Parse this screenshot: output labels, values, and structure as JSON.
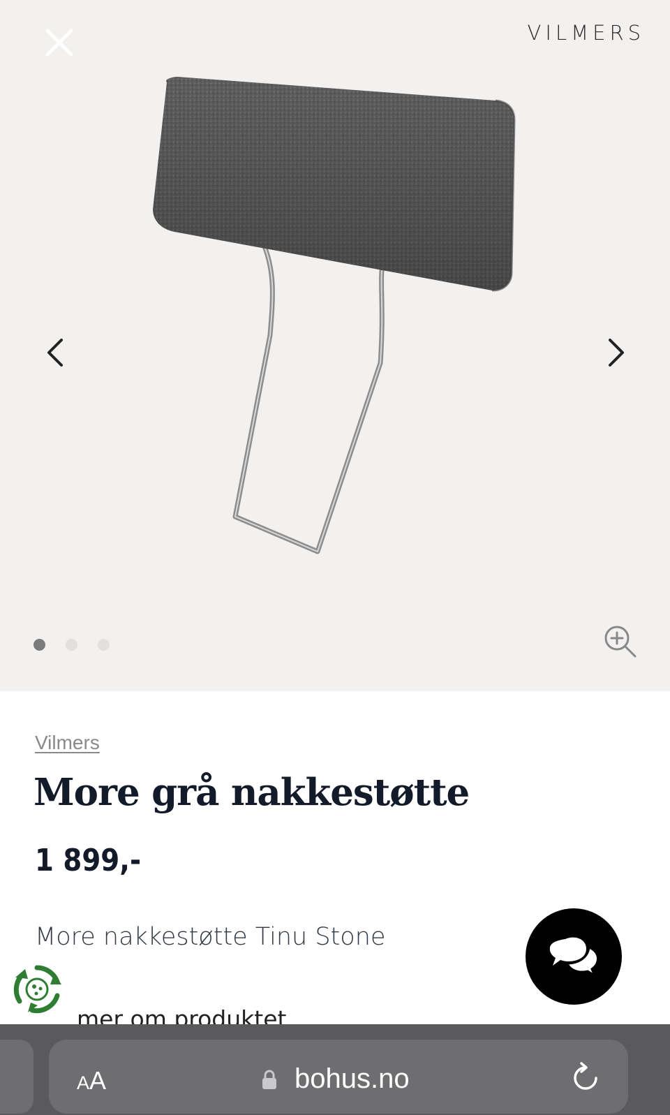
{
  "gallery": {
    "brand_logo": "VILMERS",
    "close_icon": "close-icon",
    "prev_icon": "chevron-left-icon",
    "next_icon": "chevron-right-icon",
    "zoom_icon": "zoom-in-icon",
    "image_count": 3,
    "active_image": 1
  },
  "product": {
    "brand": "Vilmers",
    "title": "More grå nakkestøtte",
    "price": "1 899,-",
    "subtitle": "More nakkestøtte Tinu Stone",
    "more_link": "mer om produktet"
  },
  "chat": {
    "icon": "chat-bubbles-icon"
  },
  "browser": {
    "aa_label_small": "A",
    "aa_label_large": "A",
    "url": "bohus.no",
    "lock_icon": "lock-icon",
    "reload_icon": "reload-icon"
  },
  "colors": {
    "gallery_bg": "#f3f1f0",
    "title_color": "#131a2a",
    "eco_green": "#2f7d32",
    "browser_bar": "#5a5a5c"
  }
}
